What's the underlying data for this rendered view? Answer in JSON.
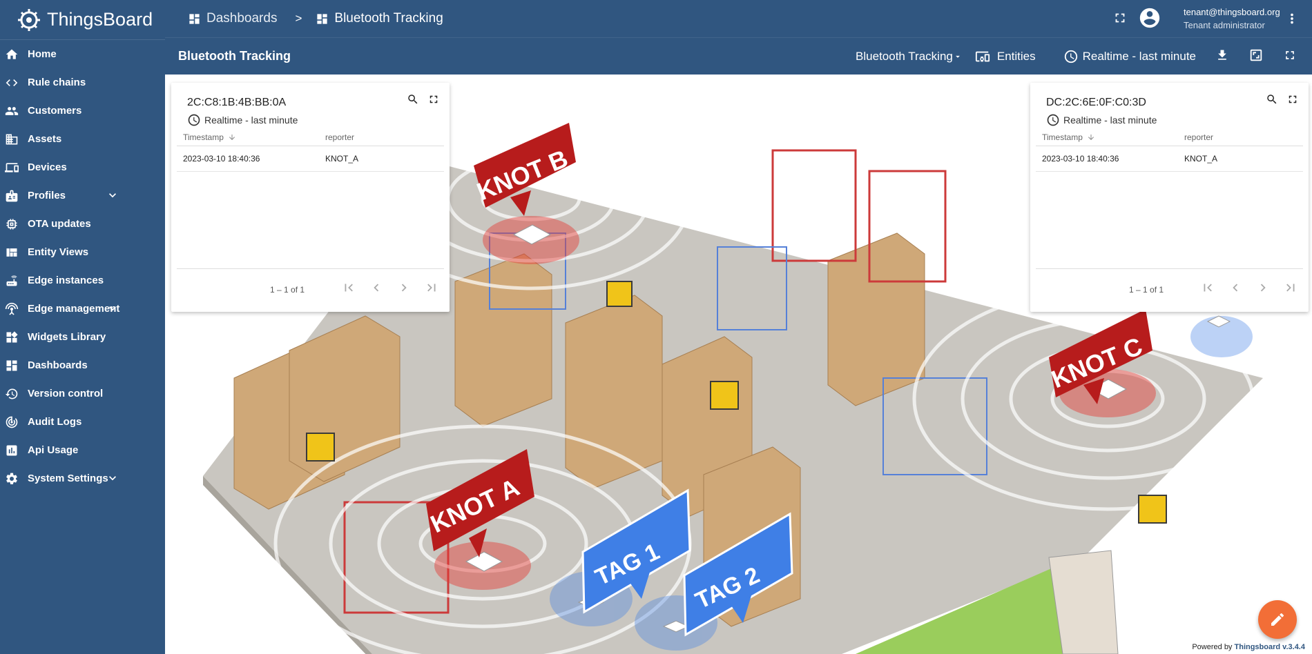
{
  "app": {
    "title": "ThingsBoard"
  },
  "nav": [
    {
      "label": "Home",
      "icon": "home-icon"
    },
    {
      "label": "Rule chains",
      "icon": "rule-chain-icon"
    },
    {
      "label": "Customers",
      "icon": "people-icon"
    },
    {
      "label": "Assets",
      "icon": "domain-icon"
    },
    {
      "label": "Devices",
      "icon": "devices-icon"
    },
    {
      "label": "Profiles",
      "icon": "badge-icon",
      "expandable": true
    },
    {
      "label": "OTA updates",
      "icon": "chip-icon"
    },
    {
      "label": "Entity Views",
      "icon": "view-quilt-icon"
    },
    {
      "label": "Edge instances",
      "icon": "router-icon"
    },
    {
      "label": "Edge management",
      "icon": "settings-input-antenna-icon",
      "expandable": true
    },
    {
      "label": "Widgets Library",
      "icon": "widgets-icon"
    },
    {
      "label": "Dashboards",
      "icon": "dashboard-icon"
    },
    {
      "label": "Version control",
      "icon": "history-icon"
    },
    {
      "label": "Audit Logs",
      "icon": "track-changes-icon"
    },
    {
      "label": "Api Usage",
      "icon": "insert-chart-icon"
    },
    {
      "label": "System Settings",
      "icon": "gear-icon",
      "expandable": true
    }
  ],
  "breadcrumb": {
    "parent": "Dashboards",
    "separator": ">",
    "current": "Bluetooth Tracking"
  },
  "user": {
    "email": "tenant@thingsboard.org",
    "role": "Tenant administrator"
  },
  "dashboard": {
    "title": "Bluetooth Tracking",
    "state_select": "Bluetooth Tracking",
    "entities_label": "Entities",
    "timewindow_label": "Realtime - last minute"
  },
  "widgets": [
    {
      "title": "2C:C8:1B:4B:BB:0A",
      "timewindow": "Realtime - last minute",
      "columns": [
        "Timestamp",
        "reporter"
      ],
      "rows": [
        [
          "2023-03-10 18:40:36",
          "KNOT_A"
        ]
      ],
      "pagination": "1 – 1 of 1"
    },
    {
      "title": "DC:2C:6E:0F:C0:3D",
      "timewindow": "Realtime - last minute",
      "columns": [
        "Timestamp",
        "reporter"
      ],
      "rows": [
        [
          "2023-03-10 18:40:36",
          "KNOT_A"
        ]
      ],
      "pagination": "1 – 1 of 1"
    }
  ],
  "map_labels": {
    "knot_a": "KNOT A",
    "knot_b": "KNOT B",
    "knot_c": "KNOT C",
    "tag_1": "TAG 1",
    "tag_2": "TAG 2"
  },
  "footer": {
    "powered_prefix": "Powered by",
    "powered_brand": "Thingsboard v.3.4.4"
  },
  "colors": {
    "primary": "#305680",
    "fab": "#f26e37",
    "knot": "#b71c1c",
    "tag": "#3f7fe6"
  }
}
